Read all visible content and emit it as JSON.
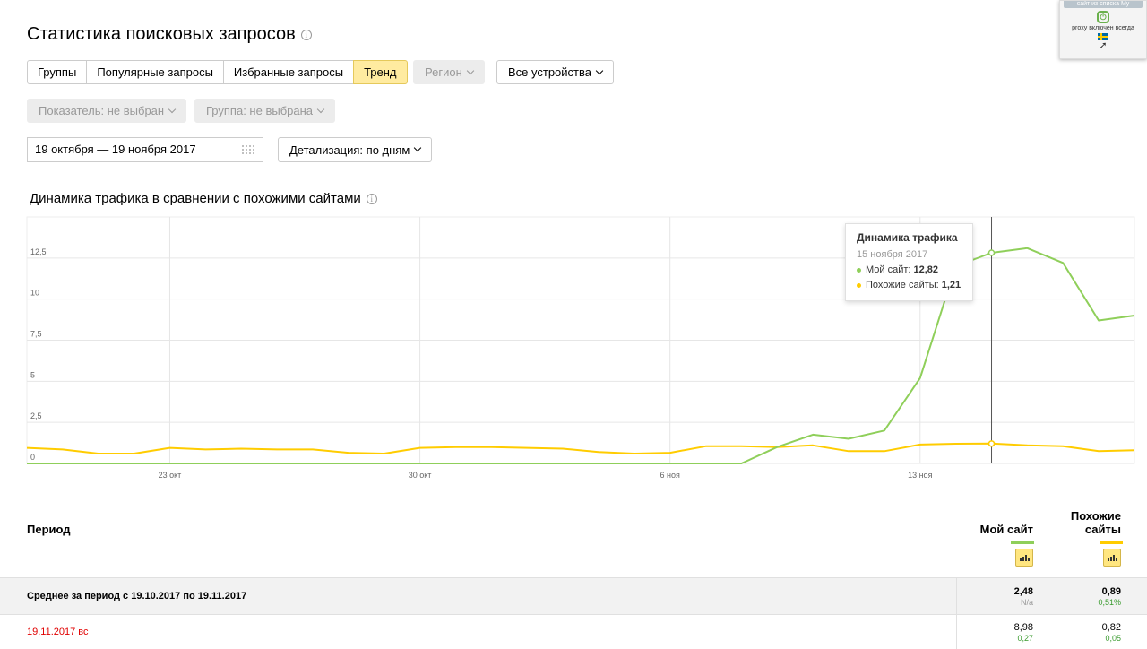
{
  "page_title": "Статистика поисковых запросов",
  "tabs": [
    {
      "label": "Группы",
      "active": false
    },
    {
      "label": "Популярные запросы",
      "active": false
    },
    {
      "label": "Избранные запросы",
      "active": false
    },
    {
      "label": "Тренд",
      "active": true
    }
  ],
  "filters": {
    "region": "Регион",
    "devices": "Все устройства",
    "indicator": "Показатель: не выбран",
    "group": "Группа: не выбрана",
    "date_range": "19 октября — 19 ноября 2017",
    "detail": "Детализация: по дням"
  },
  "section_title": "Динамика трафика в сравнении с похожими сайтами",
  "tooltip": {
    "title": "Динамика трафика",
    "date": "15 ноября 2017",
    "my_label": "Мой сайт:",
    "my_value": "12,82",
    "similar_label": "Похожие сайты:",
    "similar_value": "1,21"
  },
  "extension": {
    "header": "сайт из списка My",
    "power": "⏻",
    "text": "proxy включен всегда",
    "arrow": "➚"
  },
  "chart_data": {
    "type": "line",
    "x": [
      "19.10",
      "20.10",
      "21.10",
      "22.10",
      "23.10",
      "24.10",
      "25.10",
      "26.10",
      "27.10",
      "28.10",
      "29.10",
      "30.10",
      "31.10",
      "01.11",
      "02.11",
      "03.11",
      "04.11",
      "05.11",
      "06.11",
      "07.11",
      "08.11",
      "09.11",
      "10.11",
      "11.11",
      "12.11",
      "13.11",
      "14.11",
      "15.11",
      "16.11",
      "17.11",
      "18.11",
      "19.11"
    ],
    "x_ticks": [
      {
        "label": "23 окт",
        "index": 4
      },
      {
        "label": "30 окт",
        "index": 11
      },
      {
        "label": "6 ноя",
        "index": 18
      },
      {
        "label": "13 ноя",
        "index": 25
      }
    ],
    "y_ticks": [
      "0",
      "2,5",
      "5",
      "7,5",
      "10",
      "12,5"
    ],
    "ylim": [
      0,
      15
    ],
    "series": [
      {
        "name": "Мой сайт",
        "color": "#8fcf5a",
        "values": [
          0,
          0,
          0,
          0,
          0,
          0,
          0,
          0,
          0,
          0,
          0,
          0,
          0,
          0,
          0,
          0,
          0,
          0,
          0,
          0,
          0,
          1.0,
          1.75,
          1.5,
          2.0,
          5.2,
          12.0,
          12.82,
          13.1,
          12.2,
          8.7,
          9.0
        ]
      },
      {
        "name": "Похожие сайты",
        "color": "#ffcc00",
        "values": [
          0.95,
          0.85,
          0.6,
          0.6,
          0.95,
          0.85,
          0.9,
          0.85,
          0.85,
          0.65,
          0.6,
          0.95,
          1.0,
          1.0,
          0.95,
          0.9,
          0.7,
          0.6,
          0.65,
          1.05,
          1.05,
          1.0,
          1.1,
          0.75,
          0.75,
          1.15,
          1.2,
          1.21,
          1.1,
          1.05,
          0.75,
          0.8
        ]
      }
    ],
    "highlight_index": 27,
    "grid": true
  },
  "table": {
    "period_header": "Период",
    "col_my": "Мой сайт",
    "col_similar_1": "Похожие",
    "col_similar_2": "сайты",
    "rows": [
      {
        "label": "Среднее за период с 19.10.2017 по 19.11.2017",
        "my": "2,48",
        "my_sub": "N/a",
        "sim": "0,89",
        "sim_sub": "0,51%"
      },
      {
        "label": "19.11.2017 вс",
        "my": "8,98",
        "my_sub": "0,27",
        "sim": "0,82",
        "sim_sub": "0,05"
      }
    ]
  },
  "colors": {
    "my_site": "#8fcf5a",
    "similar": "#ffcc00",
    "active_tab": "#ffeba0",
    "weekend": "#e00000"
  }
}
